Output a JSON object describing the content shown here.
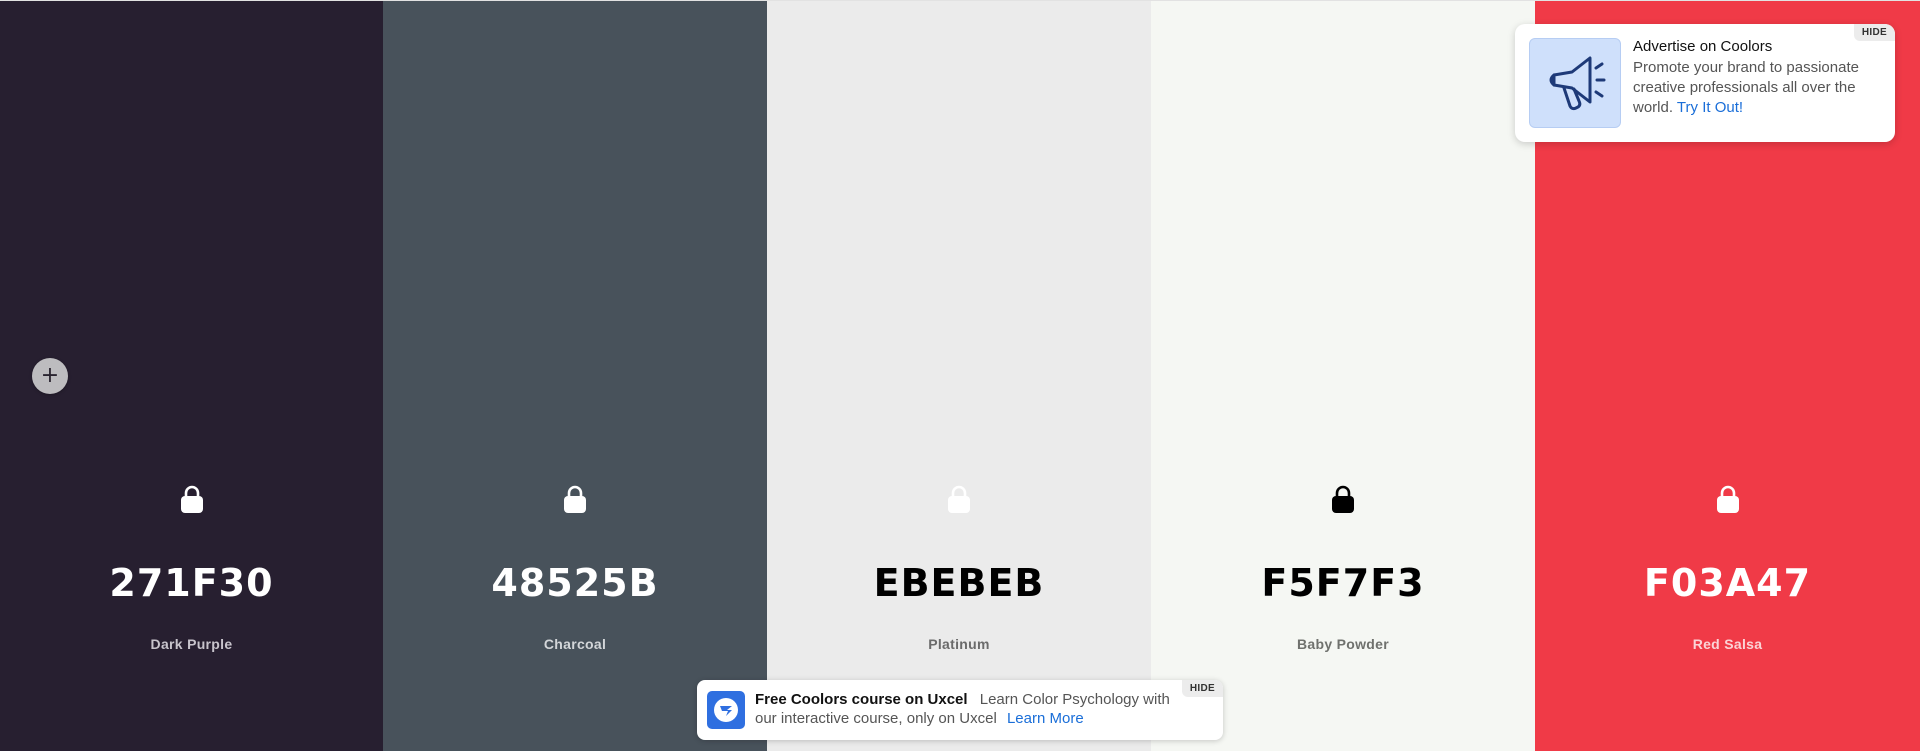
{
  "palette": [
    {
      "hex": "271F30",
      "name": "Dark Purple",
      "bg": "#271F30",
      "fg": "#ffffff",
      "name_color": "#c8c4cc",
      "locked": false,
      "lock_color": "#ffffff"
    },
    {
      "hex": "48525B",
      "name": "Charcoal",
      "bg": "#48525B",
      "fg": "#ffffff",
      "name_color": "#d3d6d9",
      "locked": false,
      "lock_color": "#ffffff"
    },
    {
      "hex": "EBEBEB",
      "name": "Platinum",
      "bg": "#EBEBEB",
      "fg": "#000000",
      "name_color": "#6b6b6b",
      "locked": false,
      "lock_color": "#ffffff"
    },
    {
      "hex": "F5F7F3",
      "name": "Baby Powder",
      "bg": "#F5F7F3",
      "fg": "#000000",
      "name_color": "#6f716d",
      "locked": true,
      "lock_color": "#000000"
    },
    {
      "hex": "F03A47",
      "name": "Red Salsa",
      "bg": "#F03A47",
      "fg": "#ffffff",
      "name_color": "#fbd3d6",
      "locked": false,
      "lock_color": "#ffffff"
    }
  ],
  "add_button": {
    "label": "+",
    "icon": "plus-icon"
  },
  "ad": {
    "title": "Advertise on Coolors",
    "body": "Promote your brand to passionate creative professionals all over the world.",
    "link": "Try It Out!",
    "hide": "HIDE",
    "icon": "megaphone-icon"
  },
  "course": {
    "title": "Free Coolors course on Uxcel",
    "body": "Learn Color Psychology with our interactive course, only on Uxcel",
    "link": "Learn More",
    "hide": "HIDE",
    "icon": "uxcel-logo-icon"
  }
}
